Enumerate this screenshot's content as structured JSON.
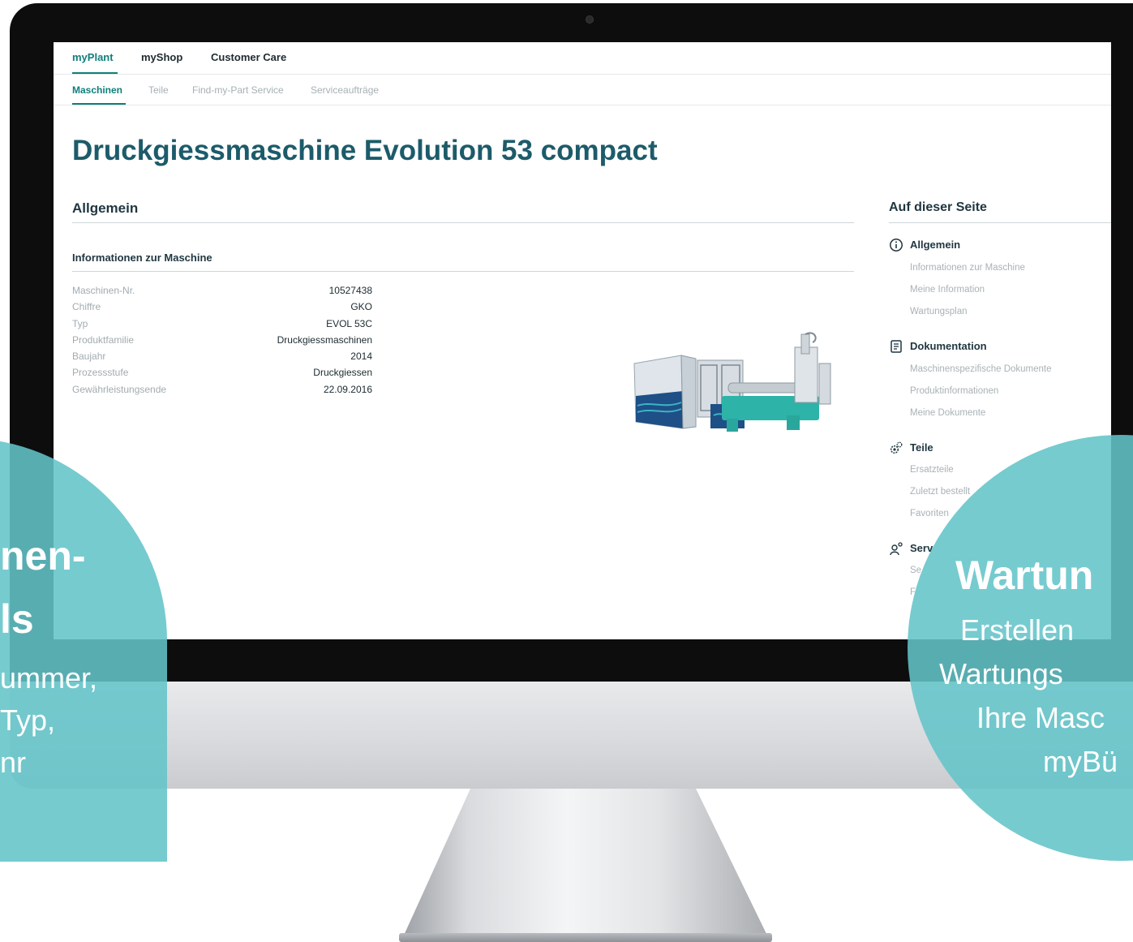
{
  "top_nav": [
    {
      "label": "myPlant",
      "active": true
    },
    {
      "label": "myShop",
      "active": false
    },
    {
      "label": "Customer Care",
      "active": false
    }
  ],
  "sub_nav": [
    {
      "label": "Maschinen",
      "active": true
    },
    {
      "label": "Teile",
      "active": false
    },
    {
      "label": "Find-my-Part Service",
      "active": false
    },
    {
      "label": "Serviceaufträge",
      "active": false
    }
  ],
  "page_title": "Druckgiessmaschine Evolution 53 compact",
  "section": {
    "title": "Allgemein",
    "subtitle": "Informationen zur Maschine"
  },
  "machine_info": [
    {
      "label": "Maschinen-Nr.",
      "value": "10527438"
    },
    {
      "label": "Chiffre",
      "value": "GKO"
    },
    {
      "label": "Typ",
      "value": "EVOL 53C"
    },
    {
      "label": "Produktfamilie",
      "value": "Druckgiessmaschinen"
    },
    {
      "label": "Baujahr",
      "value": "2014"
    },
    {
      "label": "Prozessstufe",
      "value": "Druckgiessen"
    },
    {
      "label": "Gewährleistungsende",
      "value": "22.09.2016"
    }
  ],
  "toc": {
    "title": "Auf dieser Seite",
    "groups": [
      {
        "label": "Allgemein",
        "icon": "info-icon",
        "links": [
          "Informationen zur Maschine",
          "Meine Information",
          "Wartungsplan"
        ]
      },
      {
        "label": "Dokumentation",
        "icon": "document-icon",
        "links": [
          "Maschinenspezifische Dokumente",
          "Produktinformationen",
          "Meine Dokumente"
        ]
      },
      {
        "label": "Teile",
        "icon": "gears-icon",
        "links": [
          "Ersatzteile",
          "Zuletzt bestellt",
          "Favoriten"
        ]
      },
      {
        "label": "Serv",
        "icon": "services-icon",
        "links": [
          "Se",
          "F",
          ""
        ]
      }
    ]
  },
  "overlay_left": {
    "line1": "nen-",
    "line2": "ls",
    "line3": "ummer,",
    "line4": "Typ,",
    "line5": "nr"
  },
  "overlay_right": {
    "line1": "Wartun",
    "line2": "Erstellen",
    "line3": "Wartungs",
    "line4": "Ihre Masc",
    "line5": "myBü"
  },
  "colors": {
    "accent": "#0f7f7a",
    "title": "#1c5b6a",
    "overlay": "#63c4c8"
  }
}
